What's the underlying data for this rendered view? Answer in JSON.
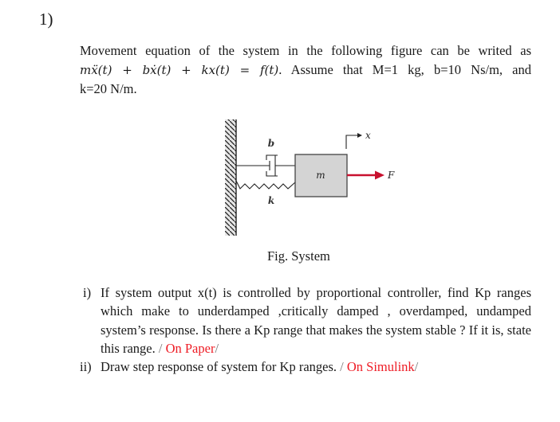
{
  "question": {
    "number": "1)",
    "intro_lines": [
      "Movement equation of the system in the following figure can be writed as",
      ". Assume that M=1 kg, b=10 Ns/m, and",
      "k=20 N/m."
    ],
    "equation": "mẍ(t) + bẋ(t) + kx(t) = f(t)",
    "figure": {
      "labels": {
        "damper": "b",
        "spring": "k",
        "mass": "m",
        "displacement": "x",
        "force": "F"
      },
      "colors": {
        "force_arrow": "#c8102e",
        "mass_fill": "#d4d4d4",
        "wall_fill": "#e6e6e6"
      },
      "caption": "Fig. System"
    },
    "items": [
      {
        "label": "i)",
        "text": "If system output x(t) is controlled by proportional controller, find Kp ranges which   make to underdamped ,critically damped , overdamped, undamped system’s response. Is there a Kp range that makes the system stable ? If it is, state this range.",
        "sep": " / ",
        "note": "On Paper",
        "tail": "/"
      },
      {
        "label": "ii)",
        "text": "Draw step response of system for  Kp ranges.",
        "sep": " / ",
        "note": "On Simulink",
        "tail": "/"
      }
    ]
  }
}
